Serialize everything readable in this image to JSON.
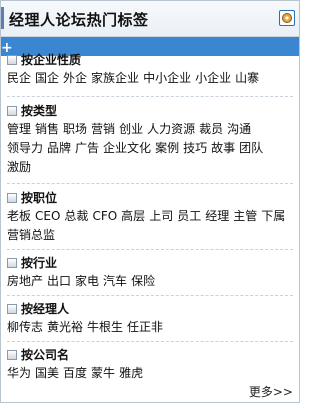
{
  "header": {
    "title": "经理人论坛热门标签"
  },
  "sections": [
    {
      "title": "按企业性质",
      "tags": [
        "民企",
        "国企",
        "外企",
        "家族企业",
        "中小企业",
        "小企业",
        "山寨"
      ]
    },
    {
      "title": "按类型",
      "tags": [
        "管理",
        "销售",
        "职场",
        "营销",
        "创业",
        "人力资源",
        "裁员",
        "沟通",
        "领导力",
        "品牌",
        "广告",
        "企业文化",
        "案例",
        "技巧",
        "故事",
        "团队",
        "激励"
      ]
    },
    {
      "title": "按职位",
      "tags": [
        "老板",
        "CEO",
        "总裁",
        "CFO",
        "高层",
        "上司",
        "员工",
        "经理",
        "主管",
        "下属",
        "营销总监"
      ]
    },
    {
      "title": "按行业",
      "tags": [
        "房地产",
        "出口",
        "家电",
        "汽车",
        "保险"
      ]
    },
    {
      "title": "按经理人",
      "tags": [
        "柳传志",
        "黄光裕",
        "牛根生",
        "任正非"
      ]
    },
    {
      "title": "按公司名",
      "tags": [
        "华为",
        "国美",
        "百度",
        "蒙牛",
        "雅虎"
      ]
    }
  ],
  "more": "更多>>"
}
